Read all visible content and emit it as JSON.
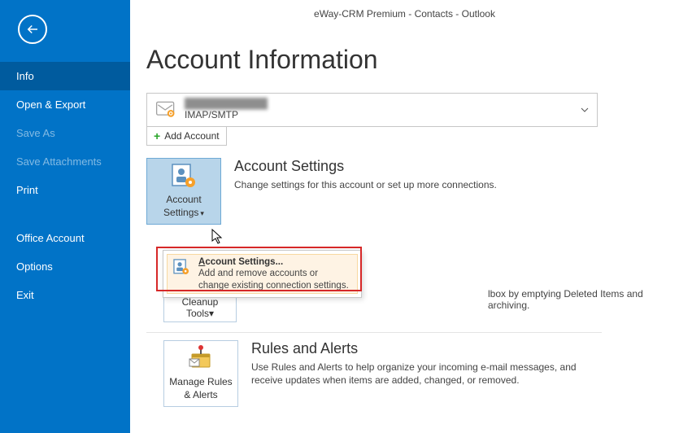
{
  "window_title": "eWay-CRM Premium - Contacts - Outlook",
  "sidebar": {
    "items": [
      {
        "label": "Info",
        "disabled": false,
        "selected": true
      },
      {
        "label": "Open & Export",
        "disabled": false,
        "selected": false
      },
      {
        "label": "Save As",
        "disabled": true,
        "selected": false
      },
      {
        "label": "Save Attachments",
        "disabled": true,
        "selected": false
      },
      {
        "label": "Print",
        "disabled": false,
        "selected": false
      },
      {
        "label": "Office Account",
        "disabled": false,
        "selected": false
      },
      {
        "label": "Options",
        "disabled": false,
        "selected": false
      },
      {
        "label": "Exit",
        "disabled": false,
        "selected": false
      }
    ]
  },
  "page_heading": "Account Information",
  "account_select": {
    "email_blur": "████████████",
    "protocol": "IMAP/SMTP"
  },
  "add_account_label": "Add Account",
  "account_settings": {
    "btn_line1": "Account",
    "btn_line2": "Settings",
    "title": "Account Settings",
    "desc": "Change settings for this account or set up more connections."
  },
  "dropdown": {
    "title": "Account Settings...",
    "line1": "Add and remove accounts or",
    "line2": "change existing connection settings."
  },
  "mailbox_tail": "lbox by emptying Deleted Items and archiving.",
  "cleanup": {
    "line1": "Cleanup",
    "line2": "Tools"
  },
  "rules": {
    "btn_line1": "Manage Rules",
    "btn_line2": "& Alerts",
    "title": "Rules and Alerts",
    "desc": "Use Rules and Alerts to help organize your incoming e-mail messages, and receive updates when items are added, changed, or removed."
  }
}
